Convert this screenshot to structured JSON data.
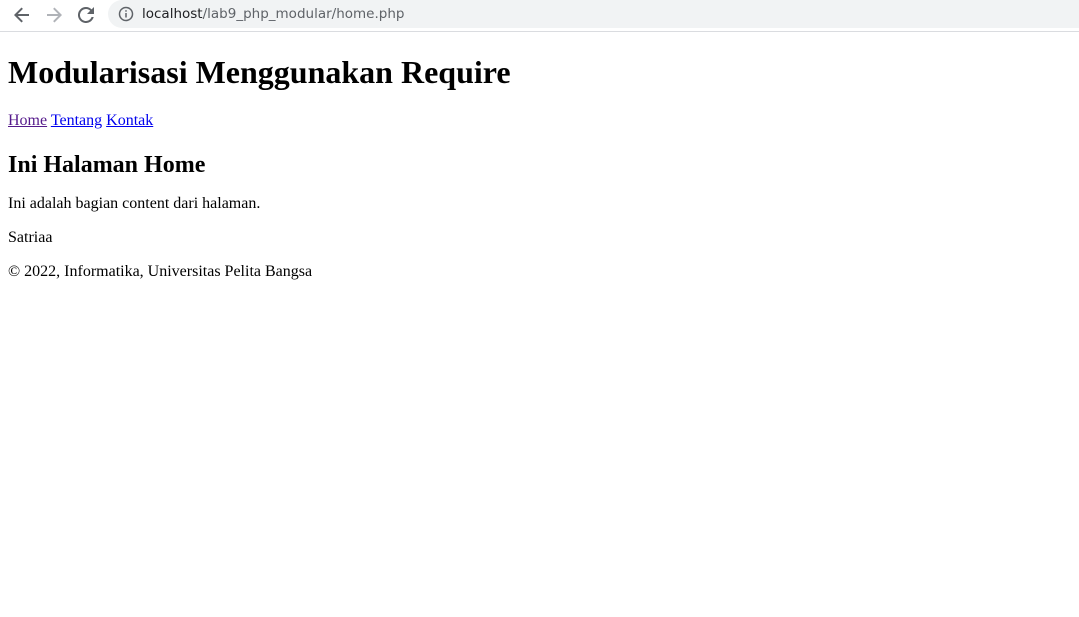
{
  "browser": {
    "url_host": "localhost",
    "url_path": "/lab9_php_modular/home.php",
    "icons": {
      "back": "arrow-left-icon",
      "forward": "arrow-right-icon",
      "reload": "reload-icon",
      "site_info": "info-icon"
    },
    "colors": {
      "toolbar_bg": "#ffffff",
      "omnibox_bg": "#f1f3f4",
      "icon_active": "#5f6368",
      "icon_disabled": "#b0b3b8"
    }
  },
  "page": {
    "title": "Modularisasi Menggunakan Require",
    "nav": [
      {
        "label": "Home",
        "visited": true
      },
      {
        "label": "Tentang",
        "visited": false
      },
      {
        "label": "Kontak",
        "visited": false
      }
    ],
    "heading": "Ini Halaman Home",
    "content": "Ini adalah bagian content dari halaman.",
    "author": "Satriaa",
    "footer": "© 2022, Informatika, Universitas Pelita Bangsa",
    "colors": {
      "link_visited": "#551a8b",
      "link_unvisited": "#0000ee"
    }
  }
}
